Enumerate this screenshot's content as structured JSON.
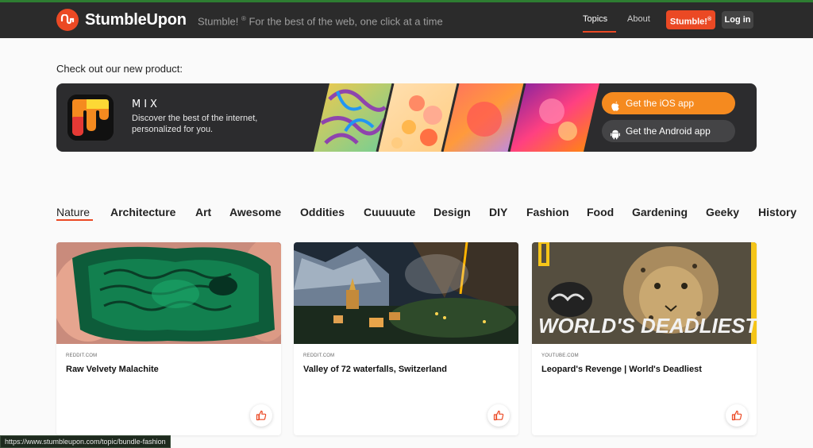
{
  "header": {
    "logo_text": "StumbleUpon",
    "tagline_prefix": "Stumble!",
    "tagline_mark": "®",
    "tagline_rest": " For the best of the web, one click at a time",
    "nav_topics": "Topics",
    "nav_about": "About",
    "stumble_button": "Stumble!",
    "stumble_button_mark": "®",
    "login_button": "Log in",
    "accent_color": "#eb4924"
  },
  "promo": {
    "heading": "Check out our new product:",
    "product_name": "MIX",
    "description": "Discover the best of the internet, personalized for you.",
    "ios_button": "Get the iOS app",
    "android_button": "Get the Android app"
  },
  "categories": [
    {
      "label": "Nature",
      "active": true
    },
    {
      "label": "Architecture"
    },
    {
      "label": "Art"
    },
    {
      "label": "Awesome"
    },
    {
      "label": "Oddities"
    },
    {
      "label": "Cuuuuute"
    },
    {
      "label": "Design"
    },
    {
      "label": "DIY"
    },
    {
      "label": "Fashion"
    },
    {
      "label": "Food"
    },
    {
      "label": "Gardening"
    },
    {
      "label": "Geeky"
    },
    {
      "label": "History"
    }
  ],
  "cards": [
    {
      "source": "REDDIT.COM",
      "title": "Raw Velvety Malachite",
      "icon": "thumbs-up-icon"
    },
    {
      "source": "REDDIT.COM",
      "title": "Valley of 72 waterfalls, Switzerland",
      "icon": "thumbs-up-icon"
    },
    {
      "source": "YOUTUBE.COM",
      "title": "Leopard's Revenge | World's Deadliest",
      "thumb_overlay": "WORLD'S DEADLIEST",
      "icon": "thumbs-up-icon"
    }
  ],
  "status_bar": {
    "url": "https://www.stumbleupon.com/topic/bundle-fashion"
  }
}
